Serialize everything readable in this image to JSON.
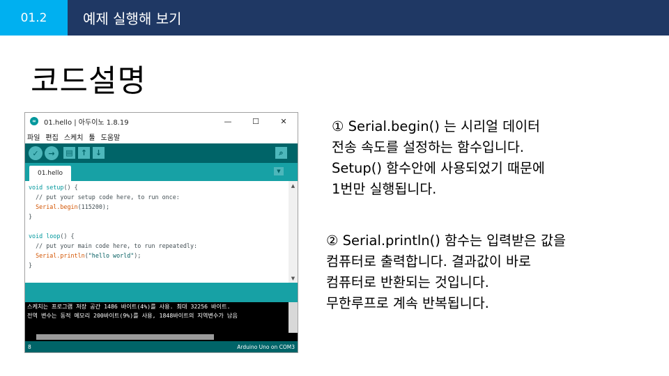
{
  "header": {
    "section_number": "01.2",
    "section_title": "예제 실행해 보기"
  },
  "slide_title": "코드설명",
  "ide": {
    "window_title": "01.hello | 아두이노 1.8.19",
    "window_controls": {
      "minimize": "—",
      "maximize": "☐",
      "close": "✕"
    },
    "menu": [
      "파일",
      "편집",
      "스케치",
      "툴",
      "도움말"
    ],
    "toolbar_icons": [
      "verify-icon",
      "upload-icon",
      "new-icon",
      "open-icon",
      "save-icon",
      "serial-monitor-icon"
    ],
    "tab_name": "01.hello",
    "code": {
      "l1_kw": "void",
      "l1_fn": "setup",
      "l1_rest": "() {",
      "l2": "  // put your setup code here, to run once:",
      "l3_fn": "Serial.begin",
      "l3_rest": "(115200);",
      "l4": "}",
      "l6_kw": "void",
      "l6_fn": "loop",
      "l6_rest": "() {",
      "l7": "  // put your main code here, to run repeatedly:",
      "l8_fn": "Serial.println",
      "l8_pre": "(",
      "l8_str": "\"hello world\"",
      "l8_post": ");",
      "l9": "}"
    },
    "console_lines": [
      "스케치는 프로그램 저장 공간 1486 바이트(4%)를 사용. 최대 32256 바이트.",
      "전역 변수는 동적 메모리 200바이트(9%)를 사용, 1848바이트의 지역변수가 남음"
    ],
    "line_number": "8",
    "board_info": "Arduino Uno on COM3"
  },
  "explanations": {
    "note1": [
      "① Serial.begin() 는 시리얼 데이터",
      "전송 속도를 설정하는 함수입니다.",
      "Setup() 함수안에 사용되었기 때문에",
      "1번만 실행됩니다."
    ],
    "note2": [
      "② Serial.println() 함수는 입력받은 값을",
      "컴퓨터로 출력합니다. 결과값이 바로",
      "컴퓨터로 반환되는 것입니다.",
      "무한루프로 계속 반복됩니다."
    ]
  }
}
